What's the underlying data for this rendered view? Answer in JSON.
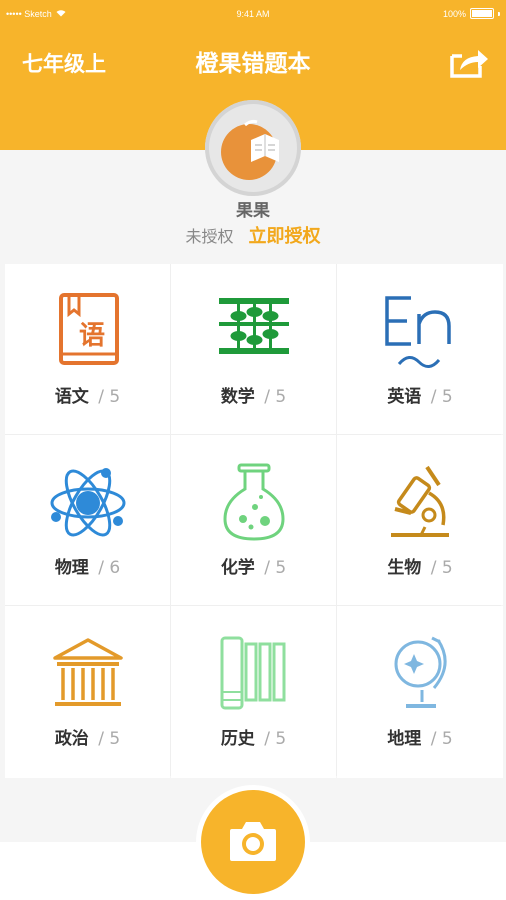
{
  "status": {
    "carrier": "••••• Sketch",
    "time": "9:41 AM",
    "battery": "100%"
  },
  "header": {
    "grade": "七年级上",
    "title": "橙果错题本"
  },
  "profile": {
    "name": "果果",
    "auth_status": "未授权",
    "auth_link": "立即授权"
  },
  "subjects": [
    {
      "name": "语文",
      "count": "/ 5",
      "icon": "book-icon",
      "color": "#e4742e"
    },
    {
      "name": "数学",
      "count": "/ 5",
      "icon": "abacus-icon",
      "color": "#1f9a3a"
    },
    {
      "name": "英语",
      "count": "/ 5",
      "icon": "en-icon",
      "color": "#2b6fb6"
    },
    {
      "name": "物理",
      "count": "/ 6",
      "icon": "atom-icon",
      "color": "#2e8ad8"
    },
    {
      "name": "化学",
      "count": "/ 5",
      "icon": "flask-icon",
      "color": "#6fd37e"
    },
    {
      "name": "生物",
      "count": "/ 5",
      "icon": "microscope-icon",
      "color": "#c58a1b"
    },
    {
      "name": "政治",
      "count": "/ 5",
      "icon": "building-icon",
      "color": "#e39a2a"
    },
    {
      "name": "历史",
      "count": "/ 5",
      "icon": "scroll-icon",
      "color": "#8fdf9e"
    },
    {
      "name": "地理",
      "count": "/ 5",
      "icon": "globe-icon",
      "color": "#7fb7e0"
    }
  ],
  "colors": {
    "brand": "#f7b42b",
    "accent": "#f2a81c"
  }
}
